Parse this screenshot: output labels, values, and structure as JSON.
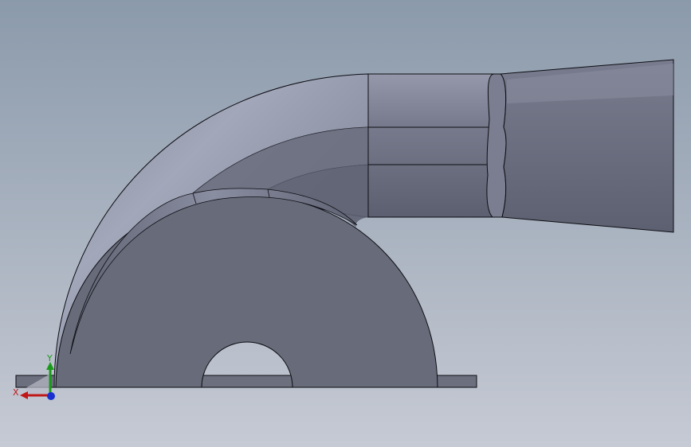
{
  "viewport": {
    "background_top": "#8b9aab",
    "background_bottom": "#c6cad4"
  },
  "model": {
    "face_color": "#676b7a",
    "edge_color": "#0d0d12"
  },
  "triad": {
    "x_label": "X",
    "y_label": "Y",
    "x_color": "#c01818",
    "y_color": "#1a9a1a",
    "z_color": "#1a2fd0"
  }
}
